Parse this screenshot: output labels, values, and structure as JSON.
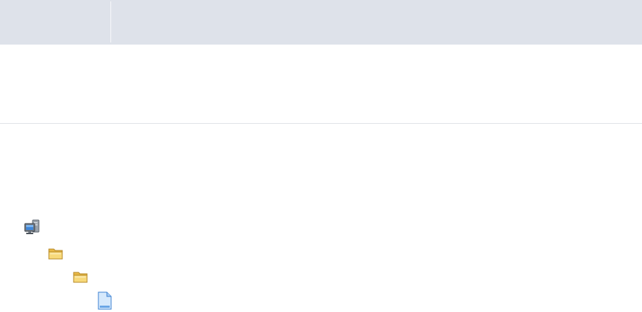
{
  "window": {
    "title": ""
  },
  "tree": {
    "nodes": [
      {
        "icon": "computer-network-icon",
        "label": ""
      },
      {
        "icon": "folder-icon",
        "label": ""
      },
      {
        "icon": "folder-icon",
        "label": ""
      },
      {
        "icon": "document-file-icon",
        "label": ""
      }
    ]
  },
  "colors": {
    "header_bg": "#dee2ea",
    "folder_fill": "#f6d36b",
    "file_fill": "#cfe5fb"
  }
}
